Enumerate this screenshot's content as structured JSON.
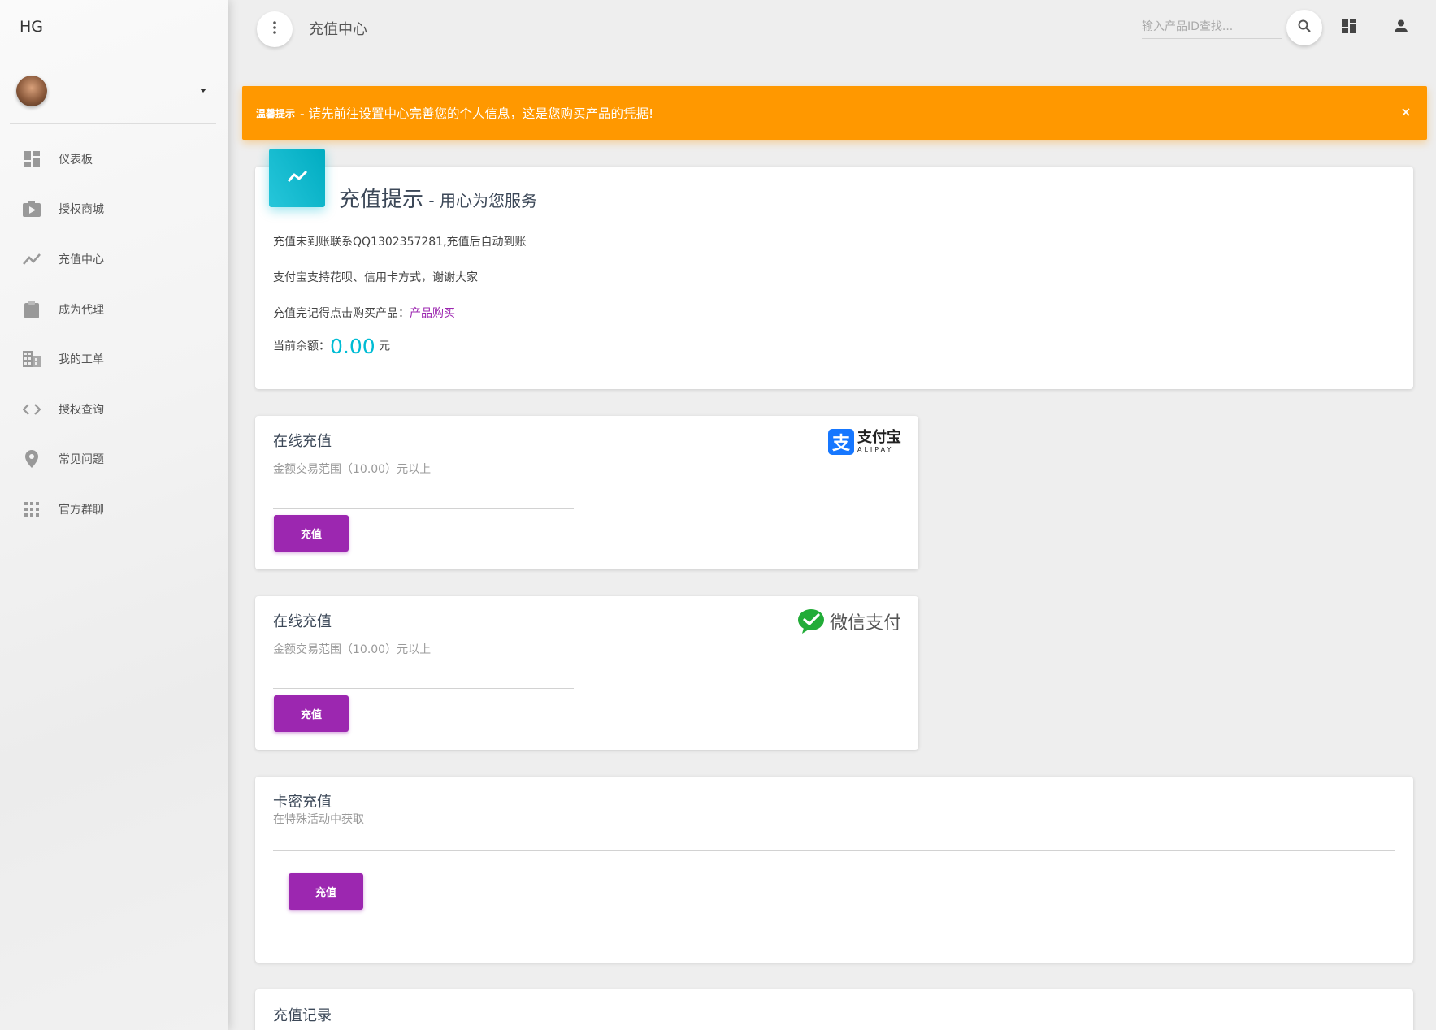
{
  "sidebar": {
    "brand": "HG",
    "items": [
      {
        "label": "仪表板"
      },
      {
        "label": "授权商城"
      },
      {
        "label": "充值中心"
      },
      {
        "label": "成为代理"
      },
      {
        "label": "我的工单"
      },
      {
        "label": "授权查询"
      },
      {
        "label": "常见问题"
      },
      {
        "label": "官方群聊"
      }
    ]
  },
  "header": {
    "title": "充值中心",
    "search_placeholder": "输入产品ID查找..."
  },
  "alert": {
    "strong": "温馨提示",
    "message": " - 请先前往设置中心完善您的个人信息，这是您购买产品的凭据!",
    "color": "#ff9800"
  },
  "tip_card": {
    "title": "充值提示",
    "subtitle": " - 用心为您服务",
    "line1": "充值未到账联系QQ1302357281,充值后自动到账",
    "line2": "支付宝支持花呗、信用卡方式，谢谢大家",
    "line3_prefix": "充值完记得点击购买产品：",
    "line3_link": "产品购买",
    "balance_label": "当前余额：",
    "balance_value": "0.00",
    "balance_unit": "元"
  },
  "alipay_card": {
    "title": "在线充值",
    "subtitle": "金额交易范围（10.00）元以上",
    "button": "充值",
    "logo_mark": "支",
    "logo_cn": "支付宝",
    "logo_en": "ALIPAY"
  },
  "wechat_card": {
    "title": "在线充值",
    "subtitle": "金额交易范围（10.00）元以上",
    "button": "充值",
    "logo_text": "微信支付"
  },
  "card_secret": {
    "title": "卡密充值",
    "subtitle": "在特殊活动中获取",
    "button": "充值"
  },
  "records": {
    "title": "充值记录"
  },
  "colors": {
    "primary": "#9c27b0",
    "info": "#00bcd4",
    "warning": "#ff9800"
  }
}
